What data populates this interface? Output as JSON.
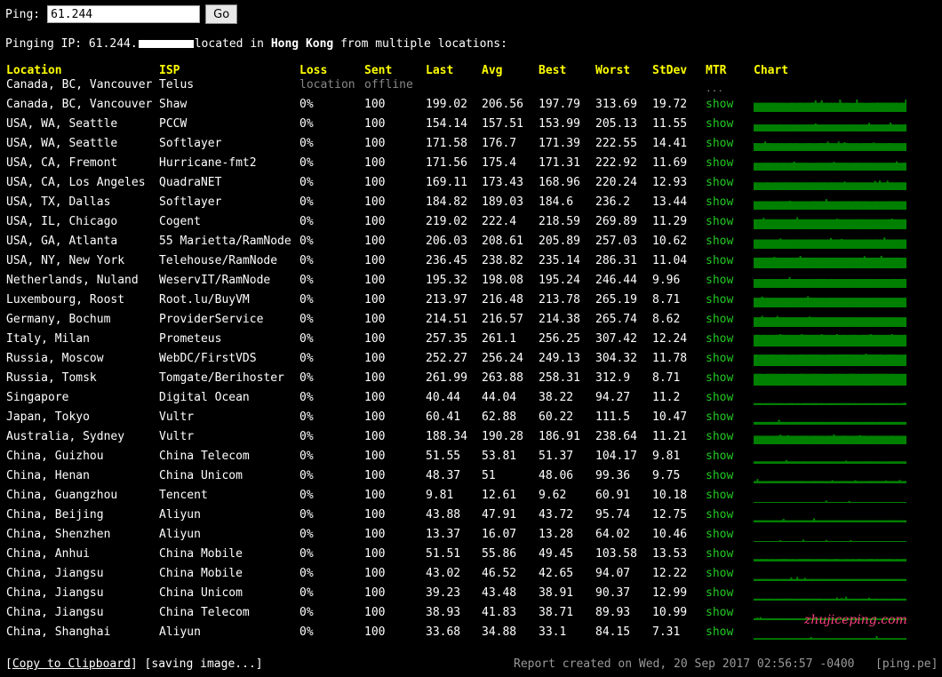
{
  "ping_form": {
    "label": "Ping:",
    "input_value": "61.244",
    "go_label": "Go"
  },
  "pinging_line": {
    "prefix": "Pinging IP: 61.244.",
    "located": "located in ",
    "location": "Hong Kong",
    "suffix": " from multiple locations:"
  },
  "headers": {
    "location": "Location",
    "isp": "ISP",
    "loss": "Loss",
    "sent": "Sent",
    "last": "Last",
    "avg": "Avg",
    "best": "Best",
    "worst": "Worst",
    "stdev": "StDev",
    "mtr": "MTR",
    "chart": "Chart"
  },
  "offline_row": {
    "location": "Canada, BC, Vancouver",
    "isp": "Telus",
    "loss": "location",
    "sent": "offline",
    "mtr": "..."
  },
  "mtr_link": "show",
  "rows": [
    {
      "location": "Canada, BC, Vancouver",
      "isp": "Shaw",
      "loss": "0%",
      "sent": "100",
      "last": "199.02",
      "avg": "206.56",
      "best": "197.79",
      "worst": "313.69",
      "stdev": "19.72"
    },
    {
      "location": "USA, WA, Seattle",
      "isp": "PCCW",
      "loss": "0%",
      "sent": "100",
      "last": "154.14",
      "avg": "157.51",
      "best": "153.99",
      "worst": "205.13",
      "stdev": "11.55"
    },
    {
      "location": "USA, WA, Seattle",
      "isp": "Softlayer",
      "loss": "0%",
      "sent": "100",
      "last": "171.58",
      "avg": "176.7",
      "best": "171.39",
      "worst": "222.55",
      "stdev": "14.41"
    },
    {
      "location": "USA, CA, Fremont",
      "isp": "Hurricane-fmt2",
      "loss": "0%",
      "sent": "100",
      "last": "171.56",
      "avg": "175.4",
      "best": "171.31",
      "worst": "222.92",
      "stdev": "11.69"
    },
    {
      "location": "USA, CA, Los Angeles",
      "isp": "QuadraNET",
      "loss": "0%",
      "sent": "100",
      "last": "169.11",
      "avg": "173.43",
      "best": "168.96",
      "worst": "220.24",
      "stdev": "12.93"
    },
    {
      "location": "USA, TX, Dallas",
      "isp": "Softlayer",
      "loss": "0%",
      "sent": "100",
      "last": "184.82",
      "avg": "189.03",
      "best": "184.6",
      "worst": "236.2",
      "stdev": "13.44"
    },
    {
      "location": "USA, IL, Chicago",
      "isp": "Cogent",
      "loss": "0%",
      "sent": "100",
      "last": "219.02",
      "avg": "222.4",
      "best": "218.59",
      "worst": "269.89",
      "stdev": "11.29"
    },
    {
      "location": "USA, GA, Atlanta",
      "isp": "55 Marietta/RamNode",
      "loss": "0%",
      "sent": "100",
      "last": "206.03",
      "avg": "208.61",
      "best": "205.89",
      "worst": "257.03",
      "stdev": "10.62"
    },
    {
      "location": "USA, NY, New York",
      "isp": "Telehouse/RamNode",
      "loss": "0%",
      "sent": "100",
      "last": "236.45",
      "avg": "238.82",
      "best": "235.14",
      "worst": "286.31",
      "stdev": "11.04"
    },
    {
      "location": "Netherlands, Nuland",
      "isp": "WeservIT/RamNode",
      "loss": "0%",
      "sent": "100",
      "last": "195.32",
      "avg": "198.08",
      "best": "195.24",
      "worst": "246.44",
      "stdev": "9.96"
    },
    {
      "location": "Luxembourg, Roost",
      "isp": "Root.lu/BuyVM",
      "loss": "0%",
      "sent": "100",
      "last": "213.97",
      "avg": "216.48",
      "best": "213.78",
      "worst": "265.19",
      "stdev": "8.71"
    },
    {
      "location": "Germany, Bochum",
      "isp": "ProviderService",
      "loss": "0%",
      "sent": "100",
      "last": "214.51",
      "avg": "216.57",
      "best": "214.38",
      "worst": "265.74",
      "stdev": "8.62"
    },
    {
      "location": "Italy, Milan",
      "isp": "Prometeus",
      "loss": "0%",
      "sent": "100",
      "last": "257.35",
      "avg": "261.1",
      "best": "256.25",
      "worst": "307.42",
      "stdev": "12.24"
    },
    {
      "location": "Russia, Moscow",
      "isp": "WebDC/FirstVDS",
      "loss": "0%",
      "sent": "100",
      "last": "252.27",
      "avg": "256.24",
      "best": "249.13",
      "worst": "304.32",
      "stdev": "11.78"
    },
    {
      "location": "Russia, Tomsk",
      "isp": "Tomgate/Berihoster",
      "loss": "0%",
      "sent": "100",
      "last": "261.99",
      "avg": "263.88",
      "best": "258.31",
      "worst": "312.9",
      "stdev": "8.71"
    },
    {
      "location": "Singapore",
      "isp": "Digital Ocean",
      "loss": "0%",
      "sent": "100",
      "last": "40.44",
      "avg": "44.04",
      "best": "38.22",
      "worst": "94.27",
      "stdev": "11.2"
    },
    {
      "location": "Japan, Tokyo",
      "isp": "Vultr",
      "loss": "0%",
      "sent": "100",
      "last": "60.41",
      "avg": "62.88",
      "best": "60.22",
      "worst": "111.5",
      "stdev": "10.47"
    },
    {
      "location": "Australia, Sydney",
      "isp": "Vultr",
      "loss": "0%",
      "sent": "100",
      "last": "188.34",
      "avg": "190.28",
      "best": "186.91",
      "worst": "238.64",
      "stdev": "11.21"
    },
    {
      "location": "China, Guizhou",
      "isp": "China Telecom",
      "loss": "0%",
      "sent": "100",
      "last": "51.55",
      "avg": "53.81",
      "best": "51.37",
      "worst": "104.17",
      "stdev": "9.81"
    },
    {
      "location": "China, Henan",
      "isp": "China Unicom",
      "loss": "0%",
      "sent": "100",
      "last": "48.37",
      "avg": "51",
      "best": "48.06",
      "worst": "99.36",
      "stdev": "9.75"
    },
    {
      "location": "China, Guangzhou",
      "isp": "Tencent",
      "loss": "0%",
      "sent": "100",
      "last": "9.81",
      "avg": "12.61",
      "best": "9.62",
      "worst": "60.91",
      "stdev": "10.18"
    },
    {
      "location": "China, Beijing",
      "isp": "Aliyun",
      "loss": "0%",
      "sent": "100",
      "last": "43.88",
      "avg": "47.91",
      "best": "43.72",
      "worst": "95.74",
      "stdev": "12.75"
    },
    {
      "location": "China, Shenzhen",
      "isp": "Aliyun",
      "loss": "0%",
      "sent": "100",
      "last": "13.37",
      "avg": "16.07",
      "best": "13.28",
      "worst": "64.02",
      "stdev": "10.46"
    },
    {
      "location": "China, Anhui",
      "isp": "China Mobile",
      "loss": "0%",
      "sent": "100",
      "last": "51.51",
      "avg": "55.86",
      "best": "49.45",
      "worst": "103.58",
      "stdev": "13.53"
    },
    {
      "location": "China, Jiangsu",
      "isp": "China Mobile",
      "loss": "0%",
      "sent": "100",
      "last": "43.02",
      "avg": "46.52",
      "best": "42.65",
      "worst": "94.07",
      "stdev": "12.22"
    },
    {
      "location": "China, Jiangsu",
      "isp": "China Unicom",
      "loss": "0%",
      "sent": "100",
      "last": "39.23",
      "avg": "43.48",
      "best": "38.91",
      "worst": "90.37",
      "stdev": "12.99"
    },
    {
      "location": "China, Jiangsu",
      "isp": "China Telecom",
      "loss": "0%",
      "sent": "100",
      "last": "38.93",
      "avg": "41.83",
      "best": "38.71",
      "worst": "89.93",
      "stdev": "10.99"
    },
    {
      "location": "China, Shanghai",
      "isp": "Aliyun",
      "loss": "0%",
      "sent": "100",
      "last": "33.68",
      "avg": "34.88",
      "best": "33.1",
      "worst": "84.15",
      "stdev": "7.31"
    }
  ],
  "chart_color": "#008000",
  "chart_scale_max_ms": 320,
  "footer": {
    "copy_label": "Copy to Clipboard",
    "saving": " [saving image...]",
    "report": "Report created on Wed, 20 Sep 2017 02:56:57 -0400",
    "brand": "[ping.pe]"
  },
  "watermark": "zhujiceping.com"
}
